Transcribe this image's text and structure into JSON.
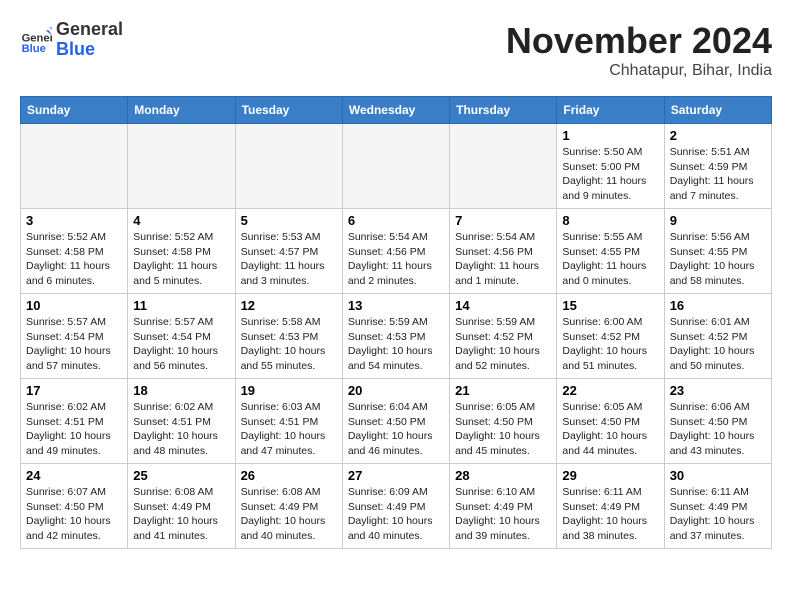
{
  "header": {
    "logo_general": "General",
    "logo_blue": "Blue",
    "month_title": "November 2024",
    "location": "Chhatapur, Bihar, India"
  },
  "weekdays": [
    "Sunday",
    "Monday",
    "Tuesday",
    "Wednesday",
    "Thursday",
    "Friday",
    "Saturday"
  ],
  "weeks": [
    [
      {
        "day": "",
        "info": ""
      },
      {
        "day": "",
        "info": ""
      },
      {
        "day": "",
        "info": ""
      },
      {
        "day": "",
        "info": ""
      },
      {
        "day": "",
        "info": ""
      },
      {
        "day": "1",
        "info": "Sunrise: 5:50 AM\nSunset: 5:00 PM\nDaylight: 11 hours and 9 minutes."
      },
      {
        "day": "2",
        "info": "Sunrise: 5:51 AM\nSunset: 4:59 PM\nDaylight: 11 hours and 7 minutes."
      }
    ],
    [
      {
        "day": "3",
        "info": "Sunrise: 5:52 AM\nSunset: 4:58 PM\nDaylight: 11 hours and 6 minutes."
      },
      {
        "day": "4",
        "info": "Sunrise: 5:52 AM\nSunset: 4:58 PM\nDaylight: 11 hours and 5 minutes."
      },
      {
        "day": "5",
        "info": "Sunrise: 5:53 AM\nSunset: 4:57 PM\nDaylight: 11 hours and 3 minutes."
      },
      {
        "day": "6",
        "info": "Sunrise: 5:54 AM\nSunset: 4:56 PM\nDaylight: 11 hours and 2 minutes."
      },
      {
        "day": "7",
        "info": "Sunrise: 5:54 AM\nSunset: 4:56 PM\nDaylight: 11 hours and 1 minute."
      },
      {
        "day": "8",
        "info": "Sunrise: 5:55 AM\nSunset: 4:55 PM\nDaylight: 11 hours and 0 minutes."
      },
      {
        "day": "9",
        "info": "Sunrise: 5:56 AM\nSunset: 4:55 PM\nDaylight: 10 hours and 58 minutes."
      }
    ],
    [
      {
        "day": "10",
        "info": "Sunrise: 5:57 AM\nSunset: 4:54 PM\nDaylight: 10 hours and 57 minutes."
      },
      {
        "day": "11",
        "info": "Sunrise: 5:57 AM\nSunset: 4:54 PM\nDaylight: 10 hours and 56 minutes."
      },
      {
        "day": "12",
        "info": "Sunrise: 5:58 AM\nSunset: 4:53 PM\nDaylight: 10 hours and 55 minutes."
      },
      {
        "day": "13",
        "info": "Sunrise: 5:59 AM\nSunset: 4:53 PM\nDaylight: 10 hours and 54 minutes."
      },
      {
        "day": "14",
        "info": "Sunrise: 5:59 AM\nSunset: 4:52 PM\nDaylight: 10 hours and 52 minutes."
      },
      {
        "day": "15",
        "info": "Sunrise: 6:00 AM\nSunset: 4:52 PM\nDaylight: 10 hours and 51 minutes."
      },
      {
        "day": "16",
        "info": "Sunrise: 6:01 AM\nSunset: 4:52 PM\nDaylight: 10 hours and 50 minutes."
      }
    ],
    [
      {
        "day": "17",
        "info": "Sunrise: 6:02 AM\nSunset: 4:51 PM\nDaylight: 10 hours and 49 minutes."
      },
      {
        "day": "18",
        "info": "Sunrise: 6:02 AM\nSunset: 4:51 PM\nDaylight: 10 hours and 48 minutes."
      },
      {
        "day": "19",
        "info": "Sunrise: 6:03 AM\nSunset: 4:51 PM\nDaylight: 10 hours and 47 minutes."
      },
      {
        "day": "20",
        "info": "Sunrise: 6:04 AM\nSunset: 4:50 PM\nDaylight: 10 hours and 46 minutes."
      },
      {
        "day": "21",
        "info": "Sunrise: 6:05 AM\nSunset: 4:50 PM\nDaylight: 10 hours and 45 minutes."
      },
      {
        "day": "22",
        "info": "Sunrise: 6:05 AM\nSunset: 4:50 PM\nDaylight: 10 hours and 44 minutes."
      },
      {
        "day": "23",
        "info": "Sunrise: 6:06 AM\nSunset: 4:50 PM\nDaylight: 10 hours and 43 minutes."
      }
    ],
    [
      {
        "day": "24",
        "info": "Sunrise: 6:07 AM\nSunset: 4:50 PM\nDaylight: 10 hours and 42 minutes."
      },
      {
        "day": "25",
        "info": "Sunrise: 6:08 AM\nSunset: 4:49 PM\nDaylight: 10 hours and 41 minutes."
      },
      {
        "day": "26",
        "info": "Sunrise: 6:08 AM\nSunset: 4:49 PM\nDaylight: 10 hours and 40 minutes."
      },
      {
        "day": "27",
        "info": "Sunrise: 6:09 AM\nSunset: 4:49 PM\nDaylight: 10 hours and 40 minutes."
      },
      {
        "day": "28",
        "info": "Sunrise: 6:10 AM\nSunset: 4:49 PM\nDaylight: 10 hours and 39 minutes."
      },
      {
        "day": "29",
        "info": "Sunrise: 6:11 AM\nSunset: 4:49 PM\nDaylight: 10 hours and 38 minutes."
      },
      {
        "day": "30",
        "info": "Sunrise: 6:11 AM\nSunset: 4:49 PM\nDaylight: 10 hours and 37 minutes."
      }
    ]
  ]
}
